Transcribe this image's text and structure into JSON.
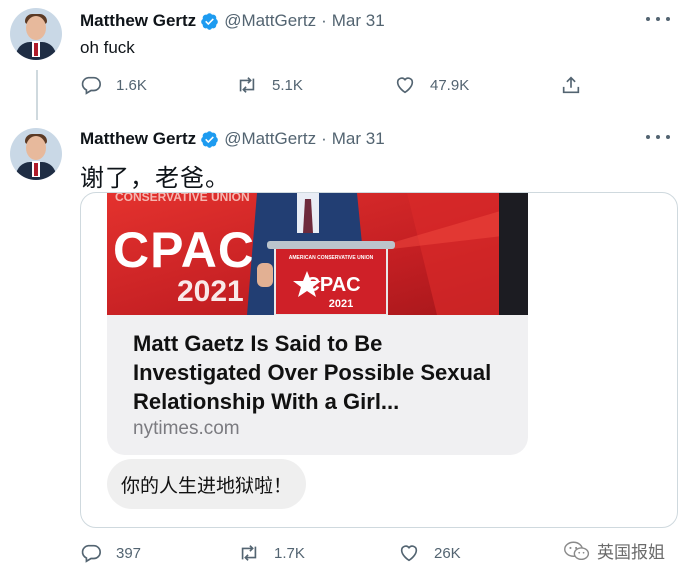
{
  "tweets": [
    {
      "author": "Matthew Gertz",
      "handle": "@MattGertz",
      "date": "Mar 31",
      "text": "oh fuck",
      "replies": "1.6K",
      "retweets": "5.1K",
      "likes": "47.9K"
    },
    {
      "author": "Matthew Gertz",
      "handle": "@MattGertz",
      "date": "Mar 31",
      "text": "谢了，老爸。",
      "replies": "397",
      "retweets": "1.7K",
      "likes": "26K",
      "card": {
        "image_sign_top": "CONSERVATIVE UNION",
        "image_logo": "CPAC",
        "image_year": "2021",
        "podium_sign_top": "AMERICAN CONSERVATIVE UNION",
        "podium_logo": "CPAC",
        "podium_year": "2021",
        "headline": "Matt Gaetz Is Said to Be Investigated Over Possible Sexual Relationship With a Girl...",
        "domain": "nytimes.com",
        "reply_bubble": "你的人生进地狱啦！"
      }
    }
  ],
  "watermark": {
    "text": "英国报姐",
    "icon": "wechat-icon"
  },
  "colors": {
    "verified": "#1d9bf0",
    "muted": "#536471",
    "border": "#cfd9de",
    "cpac_red": "#d8262a"
  }
}
